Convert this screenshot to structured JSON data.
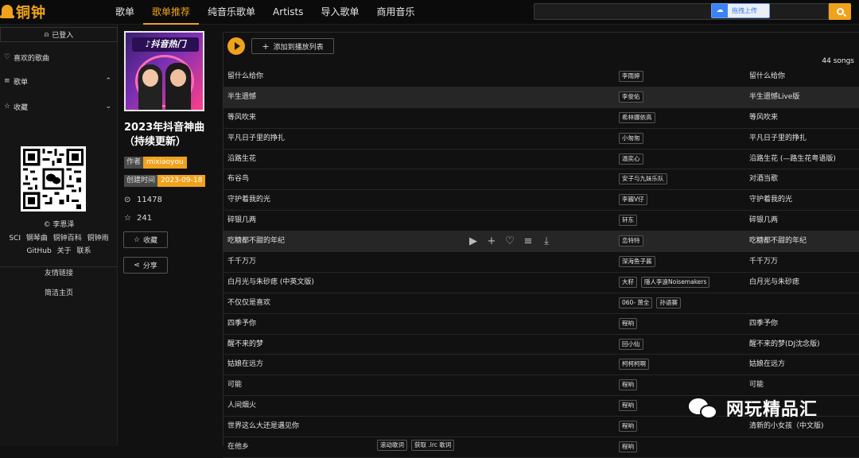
{
  "app": {
    "logo_text": "铜钟"
  },
  "nav": {
    "items": [
      "歌单",
      "歌单推荐",
      "纯音乐歌单",
      "Artists",
      "导入歌单",
      "商用音乐"
    ],
    "active": "歌单推荐"
  },
  "search": {
    "upload_label": "拖拽上传",
    "upload_icon": "cloud-upload-icon"
  },
  "sidebar": {
    "login": "已登入",
    "liked": "喜欢的歌曲",
    "playlists": "歌单",
    "favorites": "收藏",
    "copyright": "© 李恩泽",
    "links_line1": [
      "SCI",
      "钢琴曲",
      "铜钟百科",
      "铜钟雨"
    ],
    "links_line2": [
      "GitHub",
      "关于",
      "联系"
    ],
    "friends_title": "友情链接",
    "homepage": "简洁主页"
  },
  "playlist": {
    "title": "2023年抖音神曲（持续更新）",
    "author_label": "作者",
    "author": "mixiaoyou",
    "created_label": "创建时间",
    "created": "2023-09-18",
    "plays": "11478",
    "stars": "241",
    "collect_btn": "收藏",
    "share_btn": "分享"
  },
  "main": {
    "add_label": "添加到播放列表",
    "count": "44 songs"
  },
  "songs": [
    {
      "title": "留什么给你",
      "artists": [
        "李雨婷"
      ],
      "album": "留什么给你"
    },
    {
      "title": "半生遗憾",
      "artists": [
        "李俊佑"
      ],
      "album": "半生遗憾Live版",
      "highlight": true
    },
    {
      "title": "等风吹来",
      "artists": [
        "希林娜依高"
      ],
      "album": "等风吹来"
    },
    {
      "title": "平凡日子里的挣扎",
      "artists": [
        "小匆匆"
      ],
      "album": "平凡日子里的挣扎"
    },
    {
      "title": "沿路生花",
      "artists": [
        "温奕心"
      ],
      "album": "沿路生花 (—路生花粤语版)"
    },
    {
      "title": "布谷鸟",
      "artists": [
        "安子与九妹乐队"
      ],
      "album": "对酒当歌"
    },
    {
      "title": "守护着我的光",
      "artists": [
        "李巍V仔"
      ],
      "album": "守护着我的光"
    },
    {
      "title": "碎银几两",
      "artists": [
        "轩东"
      ],
      "album": "碎银几两"
    },
    {
      "title": "吃糖都不甜的年纪",
      "artists": [
        "恋特特"
      ],
      "album": "吃糖都不甜的年纪",
      "highlight": true,
      "hover": true
    },
    {
      "title": "千千万万",
      "artists": [
        "深海鱼子酱"
      ],
      "album": "千千万万"
    },
    {
      "title": "白月光与朱砂痣 (中英文版)",
      "artists": [
        "大籽",
        "隱人李遠Noisemakers"
      ],
      "album": "白月光与朱砂痣"
    },
    {
      "title": "不仅仅是喜欢",
      "artists": [
        "060- 萧全",
        "孙语赛"
      ],
      "album": ""
    },
    {
      "title": "四季予你",
      "artists": [
        "程响"
      ],
      "album": "四季予你"
    },
    {
      "title": "醒不来的梦",
      "artists": [
        "回小仙"
      ],
      "album": "醒不来的梦(DJ沈念版)"
    },
    {
      "title": "姑娘在远方",
      "artists": [
        "柯柯柯啊"
      ],
      "album": "姑娘在远方"
    },
    {
      "title": "可能",
      "artists": [
        "程响"
      ],
      "album": "可能"
    },
    {
      "title": "人间烟火",
      "artists": [
        "程响"
      ],
      "album": ""
    },
    {
      "title": "世界这么大还是遇见你",
      "artists": [
        "程响"
      ],
      "album": "清新的小女孩（中文版)"
    },
    {
      "title": "在他乡",
      "artists": [
        "程响"
      ],
      "album": "",
      "extra": [
        "滚动歌词",
        "获取 .lrc 歌词"
      ]
    }
  ],
  "row_actions": [
    "play-icon",
    "plus-icon",
    "heart-icon",
    "add-to-queue-icon",
    "download-icon"
  ],
  "watermark": {
    "text": "网玩精品汇"
  },
  "colors": {
    "accent": "#f0a21c",
    "background": "#111111",
    "upload_blue": "#3b82f6"
  }
}
